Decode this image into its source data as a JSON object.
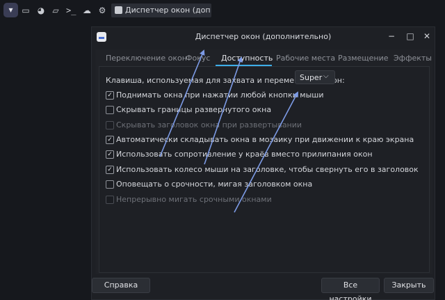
{
  "panel": {
    "icons": [
      "start-menu-icon",
      "display-icon",
      "pie-chart-icon",
      "folder-icon",
      "terminal-icon",
      "cloud-download-icon",
      "gear-icon"
    ],
    "task": {
      "label": "Диспетчер окон (дополнительно)"
    }
  },
  "window": {
    "title": "Диспетчер окон (дополнительно)",
    "controls": {
      "minimize": "−",
      "maximize": "□",
      "close": "✕"
    },
    "tabs": [
      {
        "label": "Переключение окон",
        "active": false
      },
      {
        "label": "Фокус",
        "active": false
      },
      {
        "label": "Доступность",
        "active": true
      },
      {
        "label": "Рабочие места",
        "active": false
      },
      {
        "label": "Размещение",
        "active": false
      },
      {
        "label": "Эффекты",
        "active": false
      }
    ],
    "key_label": "Клавиша, используемая для захвата и перемещения окон:",
    "key_combo": {
      "value": "Super",
      "arrow": "⌵"
    },
    "options": [
      {
        "label": "Поднимать окна при нажатии любой кнопки мыши",
        "checked": true,
        "disabled": false
      },
      {
        "label": "Скрывать границы развернутого окна",
        "checked": false,
        "disabled": false
      },
      {
        "label": "Скрывать заголовок окна при развертывании",
        "checked": false,
        "disabled": true
      },
      {
        "label": "Автоматически складывать окна в мозаику при движении к краю экрана",
        "checked": true,
        "disabled": false
      },
      {
        "label": "Использовать сопротивление у краёв вместо прилипания окон",
        "checked": true,
        "disabled": false
      },
      {
        "label": "Использовать колесо мыши на заголовке, чтобы свернуть его в заголовок",
        "checked": true,
        "disabled": false
      },
      {
        "label": "Оповещать о срочности, мигая заголовком окна",
        "checked": false,
        "disabled": false
      },
      {
        "label": "Непрерывно мигать срочными окнами",
        "checked": false,
        "disabled": true
      }
    ],
    "buttons": {
      "help": "Справка",
      "all_settings": "Все настройки",
      "close": "Закрыть"
    }
  },
  "colors": {
    "accent": "#3daee9",
    "annotation_arrow": "#7d9be6",
    "background": "#16181d"
  }
}
